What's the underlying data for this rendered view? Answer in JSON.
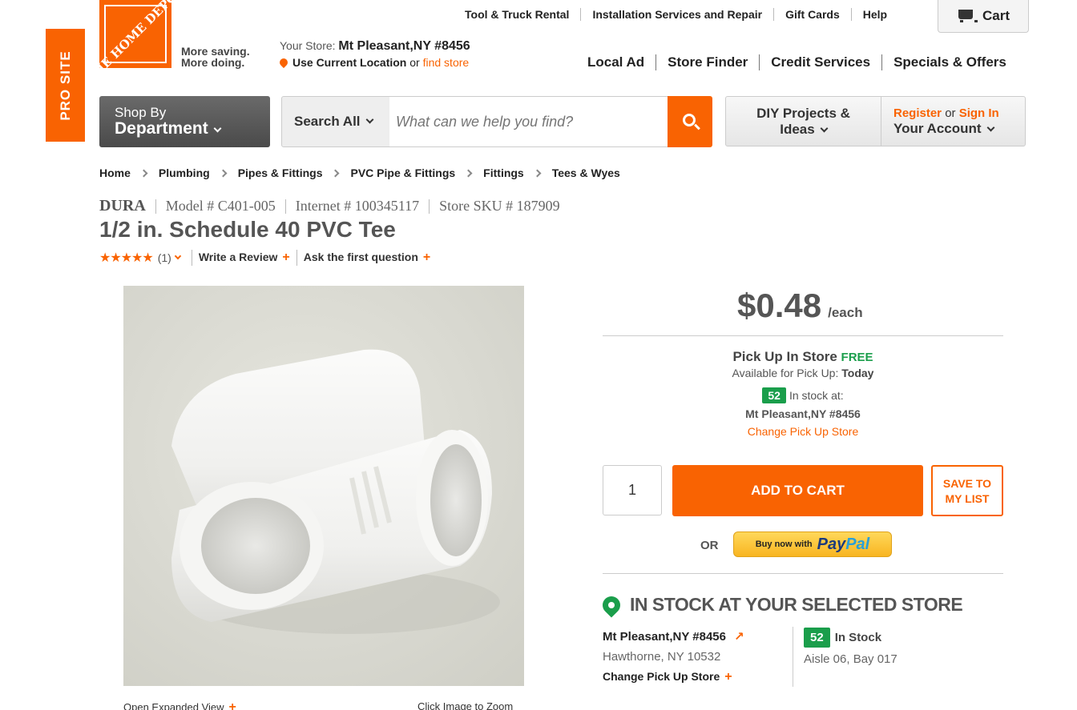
{
  "pro_site": {
    "label": "PRO SITE"
  },
  "logo": {
    "word": "THE HOME DEPOT",
    "tagline_1": "More saving.",
    "tagline_2": "More doing."
  },
  "store": {
    "your_store_label": "Your Store:",
    "your_store_value": "Mt Pleasant,NY #8456",
    "use_location": "Use Current Location",
    "or": "or",
    "find_store": "find store"
  },
  "util_nav": [
    "Tool & Truck Rental",
    "Installation Services and Repair",
    "Gift Cards",
    "Help"
  ],
  "cart": {
    "label": "Cart"
  },
  "main_nav": [
    "Local Ad",
    "Store Finder",
    "Credit Services",
    "Specials & Offers"
  ],
  "department": {
    "small": "Shop By",
    "big": "Department"
  },
  "search": {
    "scope": "Search All",
    "placeholder": "What can we help you find?"
  },
  "diy": {
    "line1": "DIY Projects &",
    "line2": "Ideas"
  },
  "account": {
    "register": "Register",
    "or": "or",
    "sign_in": "Sign In",
    "your_account": "Your Account"
  },
  "breadcrumb": [
    "Home",
    "Plumbing",
    "Pipes & Fittings",
    "PVC Pipe & Fittings",
    "Fittings",
    "Tees & Wyes"
  ],
  "product": {
    "brand": "DURA",
    "model": "Model # C401-005",
    "internet": "Internet # 100345117",
    "sku": "Store SKU # 187909",
    "title": "1/2 in. Schedule 40 PVC Tee",
    "stars": "★★★★★",
    "rating": 5,
    "review_count": "(1)",
    "write_review": "Write a Review",
    "ask_question": "Ask the first question"
  },
  "image": {
    "expand": "Open Expanded View",
    "zoom": "Click Image to Zoom"
  },
  "buy": {
    "price": "$0.48",
    "unit": "/each",
    "pickup_title": "Pick Up In Store",
    "pickup_free": "FREE",
    "available_label": "Available for Pick Up:",
    "available_value": "Today",
    "stock_count": "52",
    "in_stock_at": "In stock at:",
    "store_name": "Mt Pleasant,NY #8456",
    "change_store": "Change Pick Up Store",
    "quantity": "1",
    "add_to_cart": "ADD TO CART",
    "save_line1": "SAVE TO",
    "save_line2": "MY LIST",
    "or": "OR",
    "paypal_small": "Buy now with",
    "paypal_pay": "Pay",
    "paypal_pal": "Pal"
  },
  "store_stock": {
    "heading": "IN STOCK AT YOUR SELECTED STORE",
    "store_name": "Mt Pleasant,NY #8456",
    "address": "Hawthorne, NY 10532",
    "change": "Change Pick Up Store",
    "count": "52",
    "in_stock": "In Stock",
    "aisle": "Aisle 06, Bay 017"
  },
  "colors": {
    "brand_orange": "#f96302",
    "stock_green": "#1a9e4b",
    "paypal_yellow": "#ffc439"
  }
}
